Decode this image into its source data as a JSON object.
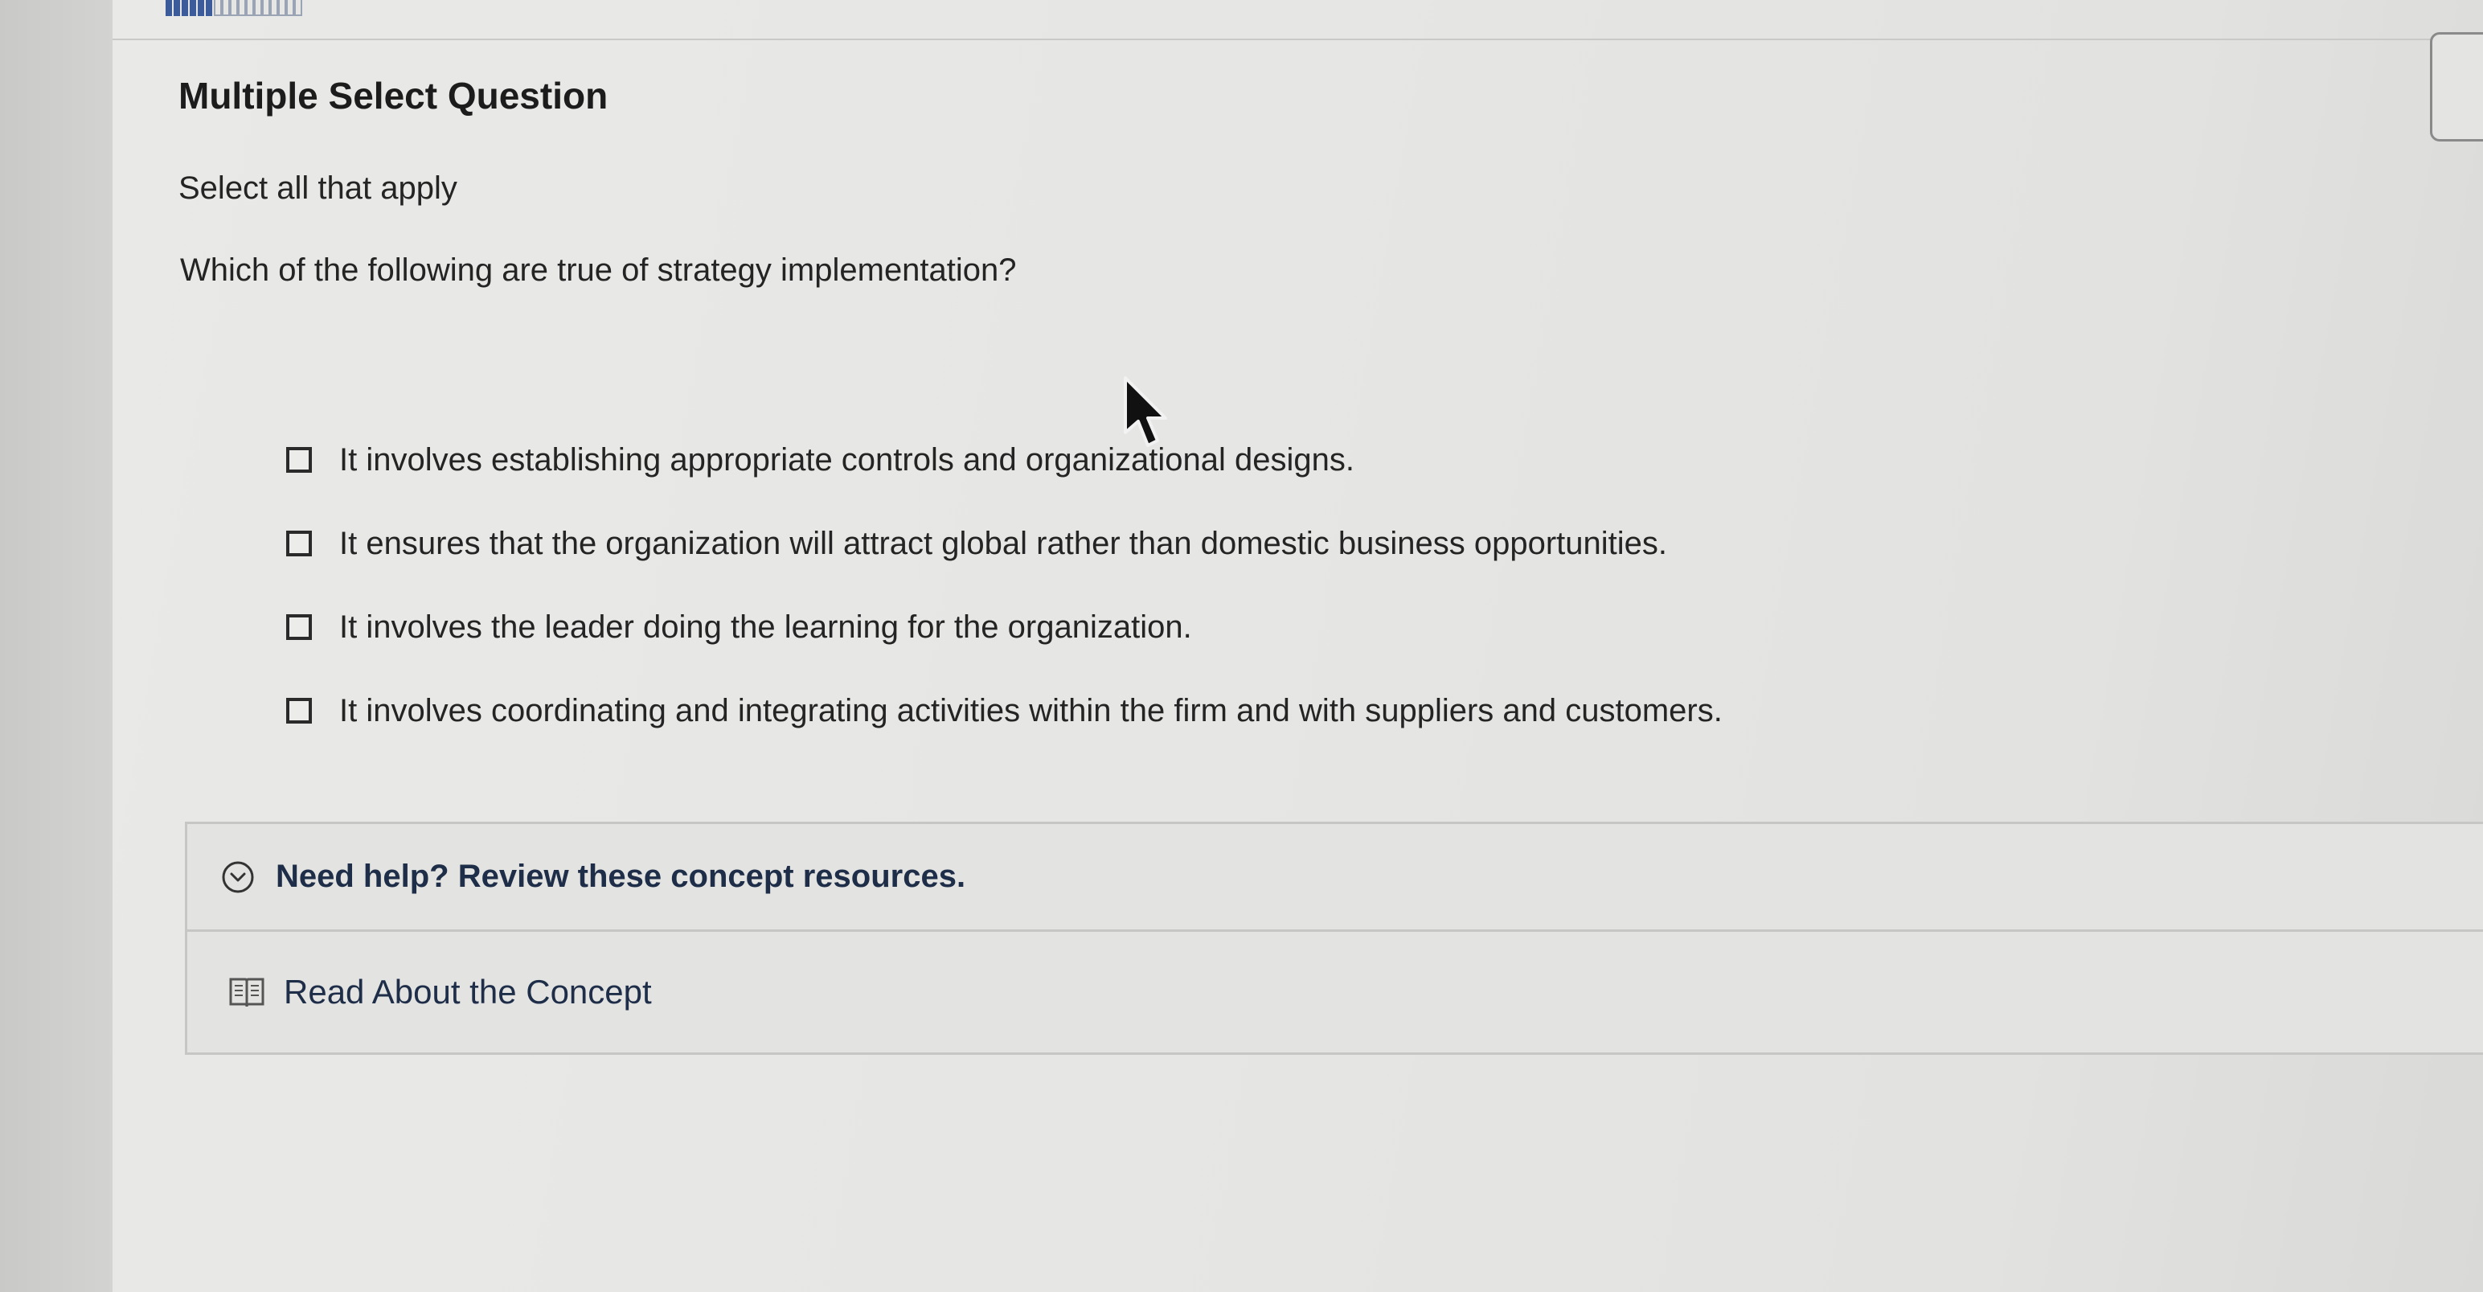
{
  "header": {
    "progress_filled": 6,
    "progress_total": 17
  },
  "question": {
    "type_label": "Multiple Select Question",
    "instruction": "Select all that apply",
    "prompt": "Which of the following are true of strategy implementation?",
    "options": [
      {
        "label": "It involves establishing appropriate controls and organizational designs.",
        "checked": false
      },
      {
        "label": "It ensures that the organization will attract global rather than domestic business opportunities.",
        "checked": false
      },
      {
        "label": "It involves the leader doing the learning for the organization.",
        "checked": false
      },
      {
        "label": "It involves coordinating and integrating activities within the firm and with suppliers and customers.",
        "checked": false
      }
    ]
  },
  "help": {
    "title": "Need help? Review these concept resources.",
    "resource_label": "Read About the Concept",
    "toggle_icon": "chevron-down-circle-icon",
    "resource_icon": "book-icon"
  },
  "colors": {
    "progress_fill": "#3b5b9b",
    "help_text": "#1e2d48",
    "text": "#242424"
  }
}
